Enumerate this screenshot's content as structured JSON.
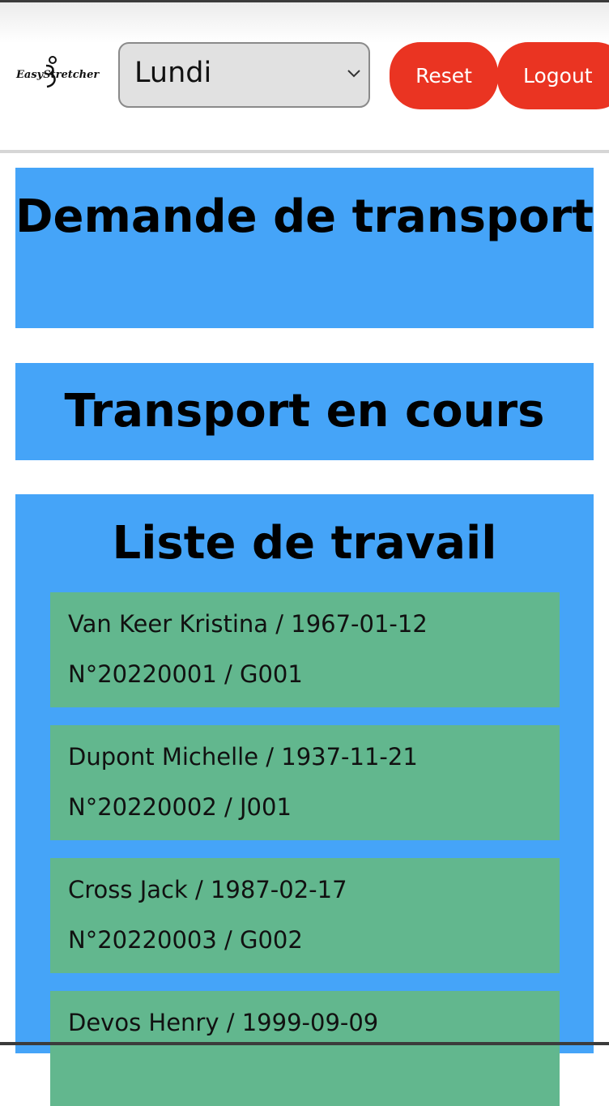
{
  "header": {
    "logo_text": "EasyStretcher",
    "day_select": {
      "selected": "Lundi"
    },
    "reset_label": "Reset",
    "logout_label": "Logout"
  },
  "sections": {
    "request_title": "Demande de transport",
    "in_progress_title": "Transport en cours",
    "worklist_title": "Liste de travail"
  },
  "worklist": {
    "items": [
      {
        "line1": "Van Keer Kristina / 1967-01-12",
        "line2": "N°20220001 / G001"
      },
      {
        "line1": "Dupont Michelle / 1937-11-21",
        "line2": "N°20220002 / J001"
      },
      {
        "line1": "Cross Jack / 1987-02-17",
        "line2": "N°20220003 / G002"
      },
      {
        "line1": "Devos Henry / 1999-09-09",
        "line2": ""
      }
    ]
  },
  "colors": {
    "card_blue": "#45a4f8",
    "item_green": "#62b78e",
    "button_red": "#ea3422"
  }
}
